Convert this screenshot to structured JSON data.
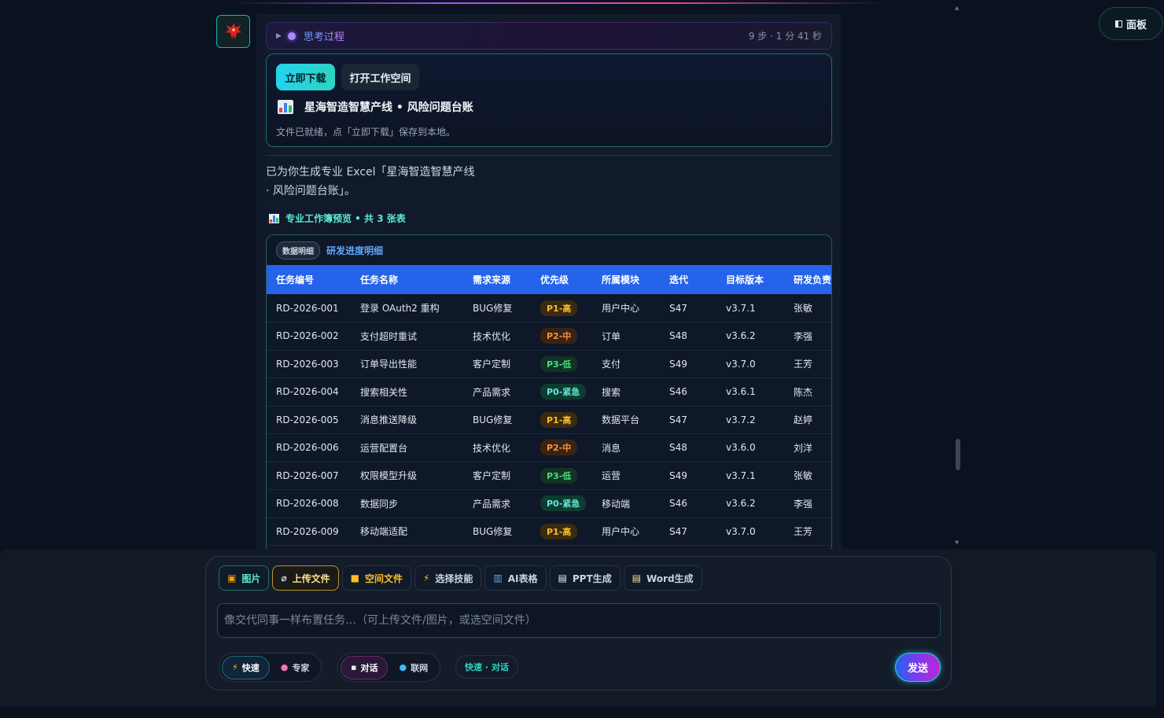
{
  "top": {
    "panel_label": "面板"
  },
  "thinking": {
    "label": "思考过程",
    "meta": "9 步 · 1 分 41 秒"
  },
  "download_card": {
    "download_label": "立即下载",
    "workspace_label": "打开工作空间",
    "file_title": "星海智造智慧产线 • 风险问题台账",
    "note": "文件已就绪，点「立即下载」保存到本地。"
  },
  "message": {
    "line1": "已为你生成专业 Excel「星海智造智慧产线",
    "line2": "· 风险问题台账」。"
  },
  "workbook": {
    "header": "专业工作簿预览 • 共 3 张表",
    "sheet_badge": "数据明细",
    "sheet_name": "研发进度明细",
    "columns": [
      "任务编号",
      "任务名称",
      "需求来源",
      "优先级",
      "所属模块",
      "迭代",
      "目标版本",
      "研发负责"
    ],
    "rows": [
      {
        "id": "RD-2026-001",
        "name": "登录 OAuth2 重构",
        "source": "BUG修复",
        "priority": "P1-高",
        "level": "high",
        "module": "用户中心",
        "iter": "S47",
        "version": "v3.7.1",
        "owner": "张敏"
      },
      {
        "id": "RD-2026-002",
        "name": "支付超时重试",
        "source": "技术优化",
        "priority": "P2-中",
        "level": "mid",
        "module": "订单",
        "iter": "S48",
        "version": "v3.6.2",
        "owner": "李强"
      },
      {
        "id": "RD-2026-003",
        "name": "订单导出性能",
        "source": "客户定制",
        "priority": "P3-低",
        "level": "low",
        "module": "支付",
        "iter": "S49",
        "version": "v3.7.0",
        "owner": "王芳"
      },
      {
        "id": "RD-2026-004",
        "name": "搜索相关性",
        "source": "产品需求",
        "priority": "P0-紧急",
        "level": "urg",
        "module": "搜索",
        "iter": "S46",
        "version": "v3.6.1",
        "owner": "陈杰"
      },
      {
        "id": "RD-2026-005",
        "name": "消息推送降级",
        "source": "BUG修复",
        "priority": "P1-高",
        "level": "high",
        "module": "数据平台",
        "iter": "S47",
        "version": "v3.7.2",
        "owner": "赵婷"
      },
      {
        "id": "RD-2026-006",
        "name": "运营配置台",
        "source": "技术优化",
        "priority": "P2-中",
        "level": "mid",
        "module": "消息",
        "iter": "S48",
        "version": "v3.6.0",
        "owner": "刘洋"
      },
      {
        "id": "RD-2026-007",
        "name": "权限模型升级",
        "source": "客户定制",
        "priority": "P3-低",
        "level": "low",
        "module": "运营",
        "iter": "S49",
        "version": "v3.7.1",
        "owner": "张敏"
      },
      {
        "id": "RD-2026-008",
        "name": "数据同步",
        "source": "产品需求",
        "priority": "P0-紧急",
        "level": "urg",
        "module": "移动端",
        "iter": "S46",
        "version": "v3.6.2",
        "owner": "李强"
      },
      {
        "id": "RD-2026-009",
        "name": "移动端适配",
        "source": "BUG修复",
        "priority": "P1-高",
        "level": "high",
        "module": "用户中心",
        "iter": "S47",
        "version": "v3.7.0",
        "owner": "王芳"
      }
    ]
  },
  "composer": {
    "chips": [
      {
        "label": "图片",
        "icon": "image-icon"
      },
      {
        "label": "上传文件",
        "icon": "paperclip-icon"
      },
      {
        "label": "空间文件",
        "icon": "folder-icon"
      },
      {
        "label": "选择技能",
        "icon": "lightning-icon"
      },
      {
        "label": "AI表格",
        "icon": "chart-icon"
      },
      {
        "label": "PPT生成",
        "icon": "document-icon"
      },
      {
        "label": "Word生成",
        "icon": "memo-icon"
      }
    ],
    "placeholder": "像交代同事一样布置任务…（可上传文件/图片，或选空间文件）",
    "mode_fast": "快速",
    "mode_expert": "专家",
    "mode_chat": "对话",
    "mode_web": "联网",
    "status": "快速 · 对话",
    "send_label": "发送"
  },
  "colors": {
    "accent_teal": "#2dd4bf",
    "table_header": "#2563eb",
    "background": "#0a1220"
  }
}
